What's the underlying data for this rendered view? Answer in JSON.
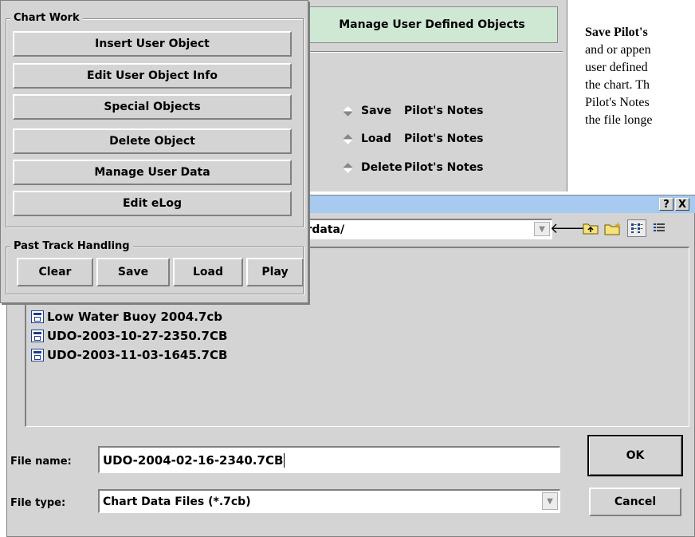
{
  "doc_text": {
    "heading_bold": "Save Pilot's",
    "line2": "and or appen",
    "line3": "user defined",
    "line4": "the chart.  Th",
    "line5": "Pilot's Notes",
    "line6": "the file longe"
  },
  "udo_panel": {
    "title": "Manage User Defined Objects",
    "options": [
      {
        "verb": "Save",
        "object": "Pilot's Notes"
      },
      {
        "verb": "Load",
        "object": "Pilot's Notes"
      },
      {
        "verb": "Delete",
        "object": "Pilot's Notes"
      }
    ]
  },
  "file_dialog": {
    "help_label": "?",
    "close_label": "X",
    "path_value": "erdata/",
    "files": [
      "Low Water Buoy 2004.7cb",
      "UDO-2003-10-27-2350.7CB",
      "UDO-2003-11-03-1645.7CB"
    ],
    "filename_label": "File name:",
    "filename_value": "UDO-2004-02-16-2340.7CB",
    "filetype_label": "File type:",
    "filetype_value": "Chart Data Files (*.7cb)",
    "ok_label": "OK",
    "cancel_label": "Cancel"
  },
  "chart_work": {
    "group_label": "Chart Work",
    "buttons": [
      "Insert User Object",
      "Edit User Object Info",
      "Special Objects",
      "Delete Object",
      "Manage User Data",
      "Edit eLog"
    ],
    "past_track_label": "Past Track Handling",
    "track_buttons": [
      "Clear",
      "Save",
      "Load",
      "Play"
    ]
  },
  "colors": {
    "panel_bg": "#d4d4d4",
    "dialog_title": "#a6caf0",
    "udo_title_bg": "#cfe8d4"
  }
}
